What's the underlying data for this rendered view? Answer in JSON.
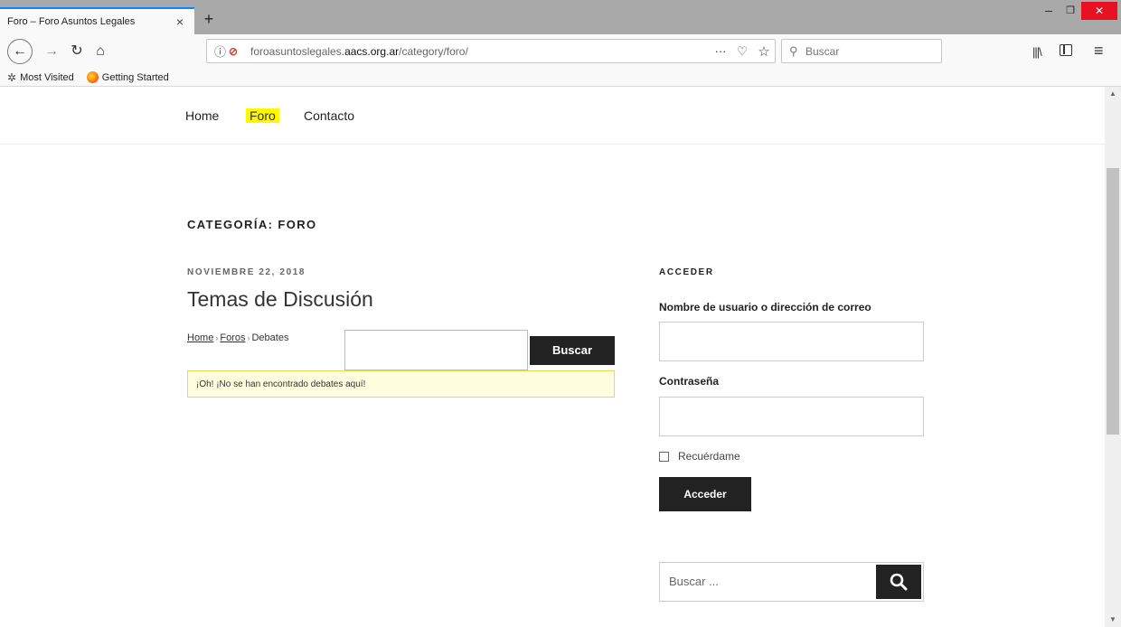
{
  "browser": {
    "tab_title": "Foro – Foro Asuntos Legales",
    "tab_close": "×",
    "new_tab": "+",
    "url_prefix": "foroasuntoslegales.",
    "url_domain": "aacs.org.ar",
    "url_path": "/category/foro/",
    "search_placeholder": "Buscar",
    "bookmarks": [
      "Most Visited",
      "Getting Started"
    ]
  },
  "site_nav": {
    "items": [
      "Home",
      "Foro",
      "Contacto"
    ],
    "active": "Foro"
  },
  "main": {
    "category_title": "CATEGORÍA: FORO",
    "post_date": "NOVIEMBRE 22, 2018",
    "post_title": "Temas de Discusión",
    "breadcrumb": [
      "Home",
      "Foros",
      "Debates"
    ],
    "breadcrumb_sep": "›",
    "forum_search_button": "Buscar",
    "notice": "¡Oh! ¡No se han encontrado debates aquí!"
  },
  "sidebar": {
    "login_title": "ACCEDER",
    "username_label": "Nombre de usuario o dirección de correo",
    "password_label": "Contraseña",
    "remember_label": "Recuérdame",
    "login_button": "Acceder",
    "search_placeholder": "Buscar ..."
  },
  "colors": {
    "highlight": "#fff800",
    "button_dark": "#222222",
    "notice_bg": "#ffffe0",
    "close_red": "#e81123"
  }
}
